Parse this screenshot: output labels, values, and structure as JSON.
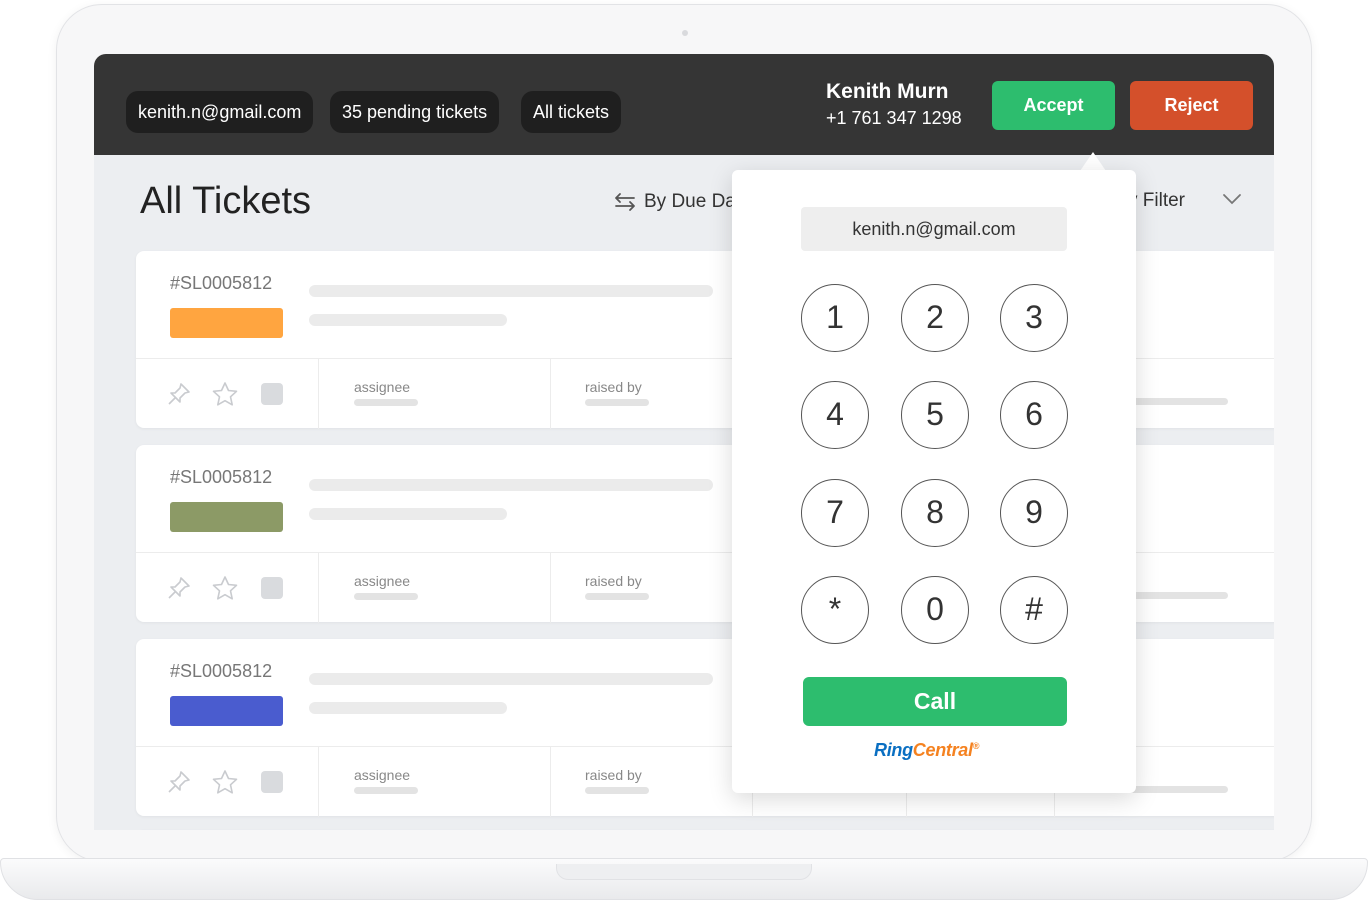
{
  "header": {
    "email_pill": "kenith.n@gmail.com",
    "pending_pill": "35 pending tickets",
    "all_tickets_pill": "All tickets",
    "caller_name": "Kenith Murn",
    "caller_phone": "+1 761 347 1298",
    "accept_label": "Accept",
    "reject_label": "Reject"
  },
  "page": {
    "title": "All Tickets",
    "sort_label": "By Due Da",
    "filter_label": "y Filter"
  },
  "tickets": [
    {
      "id": "#SL0005812",
      "tag_color": "#ffa540",
      "assignee_label": "assignee",
      "raised_by_label": "raised by"
    },
    {
      "id": "#SL0005812",
      "tag_color": "#8c9a66",
      "assignee_label": "assignee",
      "raised_by_label": "raised by"
    },
    {
      "id": "#SL0005812",
      "tag_color": "#4a5ccf",
      "assignee_label": "assignee",
      "raised_by_label": "raised by"
    }
  ],
  "dialer": {
    "email": "kenith.n@gmail.com",
    "keys": [
      "1",
      "2",
      "3",
      "4",
      "5",
      "6",
      "7",
      "8",
      "9",
      "*",
      "0",
      "#"
    ],
    "call_label": "Call",
    "brand_ring": "Ring",
    "brand_central": "Central",
    "brand_reg": "®"
  },
  "colors": {
    "topbar": "#353535",
    "accept": "#2dbd6e",
    "reject": "#d4502b"
  }
}
